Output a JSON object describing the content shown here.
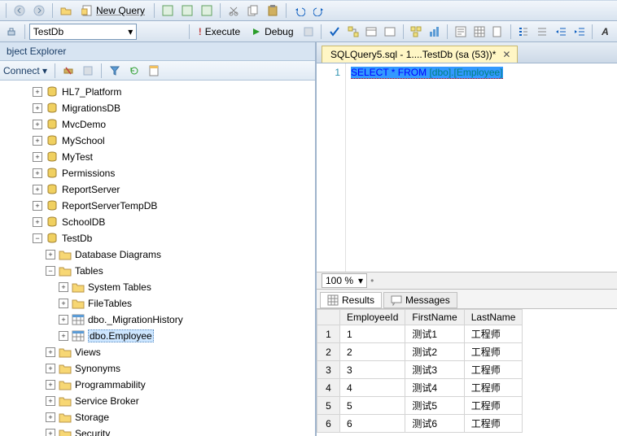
{
  "toolbar": {
    "new_query": "New Query",
    "db_selected": "TestDb",
    "execute": "Execute",
    "debug": "Debug"
  },
  "explorer": {
    "title": "bject Explorer",
    "connect": "Connect ▾",
    "nodes": [
      {
        "label": "HL7_Platform",
        "depth": 2,
        "exp": "+",
        "icon": "db"
      },
      {
        "label": "MigrationsDB",
        "depth": 2,
        "exp": "+",
        "icon": "db"
      },
      {
        "label": "MvcDemo",
        "depth": 2,
        "exp": "+",
        "icon": "db"
      },
      {
        "label": "MySchool",
        "depth": 2,
        "exp": "+",
        "icon": "db"
      },
      {
        "label": "MyTest",
        "depth": 2,
        "exp": "+",
        "icon": "db"
      },
      {
        "label": "Permissions",
        "depth": 2,
        "exp": "+",
        "icon": "db"
      },
      {
        "label": "ReportServer",
        "depth": 2,
        "exp": "+",
        "icon": "db"
      },
      {
        "label": "ReportServerTempDB",
        "depth": 2,
        "exp": "+",
        "icon": "db"
      },
      {
        "label": "SchoolDB",
        "depth": 2,
        "exp": "+",
        "icon": "db"
      },
      {
        "label": "TestDb",
        "depth": 2,
        "exp": "-",
        "icon": "db"
      },
      {
        "label": "Database Diagrams",
        "depth": 3,
        "exp": "+",
        "icon": "folder"
      },
      {
        "label": "Tables",
        "depth": 3,
        "exp": "-",
        "icon": "folder"
      },
      {
        "label": "System Tables",
        "depth": 4,
        "exp": "+",
        "icon": "folder"
      },
      {
        "label": "FileTables",
        "depth": 4,
        "exp": "+",
        "icon": "folder"
      },
      {
        "label": "dbo._MigrationHistory",
        "depth": 4,
        "exp": "+",
        "icon": "table"
      },
      {
        "label": "dbo.Employee",
        "depth": 4,
        "exp": "+",
        "icon": "table",
        "selected": true
      },
      {
        "label": "Views",
        "depth": 3,
        "exp": "+",
        "icon": "folder"
      },
      {
        "label": "Synonyms",
        "depth": 3,
        "exp": "+",
        "icon": "folder"
      },
      {
        "label": "Programmability",
        "depth": 3,
        "exp": "+",
        "icon": "folder"
      },
      {
        "label": "Service Broker",
        "depth": 3,
        "exp": "+",
        "icon": "folder"
      },
      {
        "label": "Storage",
        "depth": 3,
        "exp": "+",
        "icon": "folder"
      },
      {
        "label": "Security",
        "depth": 3,
        "exp": "+",
        "icon": "folder"
      }
    ]
  },
  "tab_title": "SQLQuery5.sql - 1....TestDb (sa (53))*",
  "sql": {
    "line_no": "1",
    "plain": "SELECT * FROM [dbo].[Employee]",
    "kw": "SELECT * FROM ",
    "obj": "[dbo].[Employee]"
  },
  "zoom": "100 %",
  "result_tabs": {
    "results": "Results",
    "messages": "Messages"
  },
  "grid": {
    "columns": [
      "EmployeeId",
      "FirstName",
      "LastName"
    ],
    "rows": [
      {
        "n": "1",
        "cells": [
          "1",
          "测试1",
          "工程师"
        ]
      },
      {
        "n": "2",
        "cells": [
          "2",
          "测试2",
          "工程师"
        ]
      },
      {
        "n": "3",
        "cells": [
          "3",
          "测试3",
          "工程师"
        ]
      },
      {
        "n": "4",
        "cells": [
          "4",
          "测试4",
          "工程师"
        ]
      },
      {
        "n": "5",
        "cells": [
          "5",
          "测试5",
          "工程师"
        ]
      },
      {
        "n": "6",
        "cells": [
          "6",
          "测试6",
          "工程师"
        ]
      }
    ]
  }
}
